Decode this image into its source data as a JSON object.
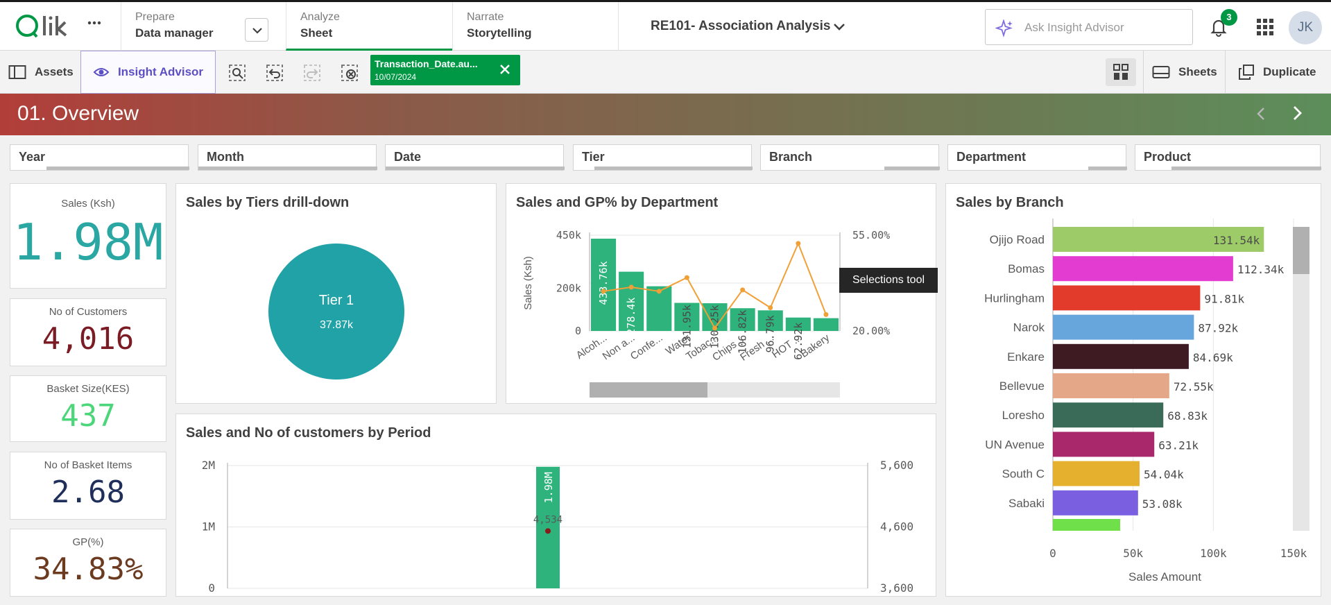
{
  "topbar": {
    "logo_text": "Qlik",
    "sections": [
      {
        "kicker": "Prepare",
        "value": "Data manager"
      },
      {
        "kicker": "Analyze",
        "value": "Sheet"
      },
      {
        "kicker": "Narrate",
        "value": "Storytelling"
      }
    ],
    "app_title": "RE101- Association Analysis",
    "ask_placeholder": "Ask Insight Advisor",
    "notifications": "3",
    "avatar_initials": "JK"
  },
  "toolbar": {
    "assets": "Assets",
    "insight_advisor": "Insight Advisor",
    "selection_chip": {
      "field": "Transaction_Date.au...",
      "value": "10/07/2024"
    },
    "sheets": "Sheets",
    "duplicate": "Duplicate"
  },
  "sheet": {
    "title": "01. Overview"
  },
  "filters": [
    "Year",
    "Month",
    "Date",
    "Tier",
    "Branch",
    "Department",
    "Product"
  ],
  "kpis": [
    {
      "label": "Sales (Ksh)",
      "value": "1.98M",
      "color": "#2aa7a3"
    },
    {
      "label": "No of Customers",
      "value": "4,016",
      "color": "#7b1c24"
    },
    {
      "label": "Basket Size(KES)",
      "value": "437",
      "color": "#4cd67a"
    },
    {
      "label": "No of Basket Items",
      "value": "2.68",
      "color": "#1f2f5a"
    },
    {
      "label": "GP(%)",
      "value": "34.83%",
      "color": "#6b3a1f"
    }
  ],
  "colors": {
    "accent_green": "#009845",
    "bar_green": "#2db37b",
    "line_orange": "#f0a037",
    "pie_teal": "#21a2a7"
  },
  "tooltip": "Selections tool",
  "chart_data": [
    {
      "id": "tiers",
      "type": "pie",
      "title": "Sales by Tiers drill-down",
      "slices": [
        {
          "label": "Tier 1",
          "value": 37.87,
          "value_label": "37.87k"
        }
      ]
    },
    {
      "id": "department",
      "type": "bar",
      "title": "Sales and GP% by Department",
      "ylabel": "Sales (Ksh)",
      "ylim": [
        0,
        450000
      ],
      "y_ticks": [
        "0",
        "200k",
        "450k"
      ],
      "y2_ticks": [
        "20.00%",
        "55.00%"
      ],
      "y2lim": [
        20,
        55
      ],
      "categories": [
        "Alcoh...",
        "Non a...",
        "Confe...",
        "Water",
        "Tobac...",
        "Chips ...",
        "Fresh ...",
        "HOT ...",
        "Bakery"
      ],
      "series": [
        {
          "type": "bar",
          "values": [
            433760,
            278400,
            210000,
            131950,
            130250,
            106820,
            96790,
            62920,
            60000
          ],
          "labels": [
            "433.76k",
            "278.4k",
            "",
            "131.95k",
            "130.25k",
            "106.82k",
            "96.79k",
            "62.92k",
            ""
          ]
        },
        {
          "type": "line",
          "values": [
            34.5,
            36,
            34.5,
            39.5,
            21,
            35,
            28.5,
            52,
            26
          ]
        }
      ]
    },
    {
      "id": "branch",
      "type": "bar",
      "orientation": "horizontal",
      "title": "Sales by Branch",
      "xlabel": "Sales Amount",
      "xlim": [
        0,
        150000
      ],
      "x_ticks": [
        "0",
        "50k",
        "100k",
        "150k"
      ],
      "categories": [
        "Ojijo Road",
        "Bomas",
        "Hurlingham",
        "Narok",
        "Enkare",
        "Bellevue",
        "Loresho",
        "UN Avenue",
        "South C",
        "Sabaki"
      ],
      "values": [
        131540,
        112340,
        91810,
        87920,
        84690,
        72550,
        68830,
        63210,
        54040,
        53080
      ],
      "labels": [
        "131.54k",
        "112.34k",
        "91.81k",
        "87.92k",
        "84.69k",
        "72.55k",
        "68.83k",
        "63.21k",
        "54.04k",
        "53.08k"
      ],
      "bar_colors": [
        "#9ccb67",
        "#e23cd0",
        "#e23b2c",
        "#66a6dd",
        "#3e1a22",
        "#e4a788",
        "#396b58",
        "#a8286b",
        "#e6b02f",
        "#7a5fe0"
      ]
    },
    {
      "id": "period",
      "type": "bar",
      "title": "Sales and No of customers by Period",
      "y_ticks": [
        "0",
        "1M",
        "2M"
      ],
      "y2_ticks": [
        "3,600",
        "4,600",
        "5,600"
      ],
      "ylim": [
        0,
        2000000
      ],
      "y2lim": [
        3600,
        5600
      ],
      "series": [
        {
          "type": "bar",
          "values": [
            1980000
          ],
          "labels": [
            "1.98M"
          ]
        },
        {
          "type": "point",
          "values": [
            4534
          ],
          "labels": [
            "4,534"
          ]
        }
      ]
    }
  ]
}
